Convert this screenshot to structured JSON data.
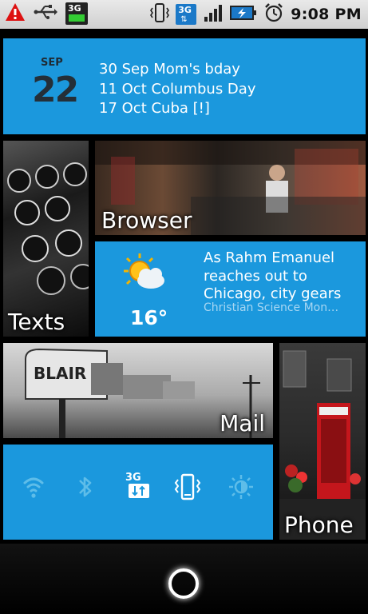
{
  "status_bar": {
    "network_badge": "3G",
    "data_badge": "3G",
    "time": "9:08 PM",
    "icons": [
      "warning-icon",
      "usb-icon",
      "3g-icon",
      "vibrate-icon",
      "3g-data-icon",
      "signal-icon",
      "battery-charging-icon",
      "alarm-icon"
    ]
  },
  "calendar": {
    "month": "SEP",
    "day": "22",
    "events": [
      "30 Sep Mom's bday",
      "11 Oct Columbus Day",
      "17 Oct Cuba [!]"
    ]
  },
  "tiles": {
    "texts": "Texts",
    "browser": "Browser",
    "mail": "Mail",
    "phone": "Phone"
  },
  "weather": {
    "temp": "16°",
    "icon": "partly-cloudy-icon"
  },
  "news": {
    "headline": "As Rahm Emanuel reaches out to Chicago, city gears",
    "source": "Christian Science Mon…"
  },
  "quick_settings": {
    "badge": "3G",
    "icons": [
      "wifi-icon",
      "bluetooth-icon",
      "mobile-data-icon",
      "vibrate-icon",
      "brightness-icon"
    ]
  },
  "colors": {
    "tile_blue": "#1b98dd",
    "status_bar": "#dcdcdc",
    "background": "#000000"
  }
}
